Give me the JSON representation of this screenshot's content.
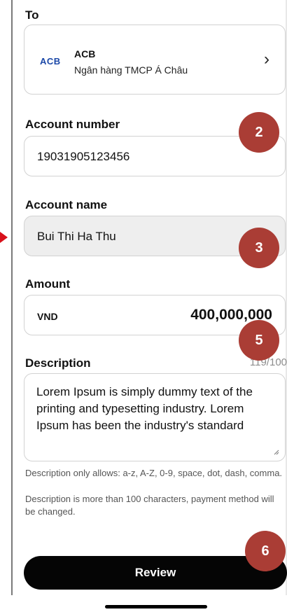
{
  "to_section": {
    "label": "To",
    "bank_logo": "ACB",
    "bank_code": "ACB",
    "bank_name": "Ngân hàng TMCP Á Châu",
    "chevron_icon": "chevron-right-icon"
  },
  "account_number": {
    "label": "Account number",
    "value": "19031905123456"
  },
  "account_name": {
    "label": "Account name",
    "value": "Bui Thi Ha Thu"
  },
  "amount": {
    "label": "Amount",
    "currency": "VND",
    "value": "400,000,000"
  },
  "description": {
    "label": "Description",
    "counter": "119/100",
    "value": "Lorem Ipsum is simply dummy text of the printing and typesetting industry. Lorem Ipsum has been the industry's standard",
    "helper_allowed": "Description only allows: a-z, A-Z, 0-9, space, dot, dash, comma.",
    "helper_length": "Description is more than 100 characters, payment method will be changed."
  },
  "review_button": {
    "label": "Review"
  },
  "badges": {
    "badge_2": "2",
    "badge_3": "3",
    "badge_5": "5",
    "badge_6": "6"
  },
  "colors": {
    "primary_button": "#050505",
    "badge": "#aa3d35",
    "marker": "#d8111b",
    "bank_logo": "#1b48a8"
  }
}
